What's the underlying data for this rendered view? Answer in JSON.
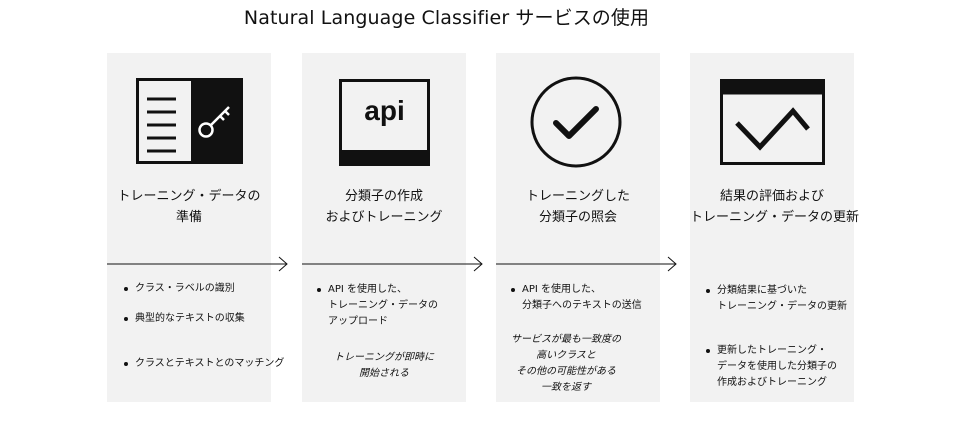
{
  "title": "Natural Language Classifier サービスの使用",
  "steps": [
    {
      "heading": [
        "トレーニング・データの",
        "準備"
      ],
      "bullets": [
        "クラス・ラベルの識別",
        "典型的なテキストの収集",
        "クラスとテキストとのマッチング"
      ],
      "note": []
    },
    {
      "icon_text": "api",
      "heading": [
        "分類子の作成",
        "およびトレーニング"
      ],
      "bullets": [
        [
          "API を使用した、",
          "トレーニング・データの",
          "アップロード"
        ]
      ],
      "note": [
        "トレーニングが即時に",
        "開始される"
      ]
    },
    {
      "heading": [
        "トレーニングした",
        "分類子の照会"
      ],
      "bullets": [
        [
          "API を使用した、",
          "分類子へのテキストの送信"
        ]
      ],
      "note": [
        "サービスが最も一致度の",
        "高いクラスと",
        "その他の可能性がある",
        "一致を返す"
      ]
    },
    {
      "heading": [
        "結果の評価および",
        "トレーニング・データの更新"
      ],
      "bullets": [
        [
          "分類結果に基づいた",
          "トレーニング・データの更新"
        ],
        [
          "更新したトレーニング・",
          "データを使用した分類子の",
          "作成およびトレーニング"
        ]
      ],
      "note": []
    }
  ]
}
